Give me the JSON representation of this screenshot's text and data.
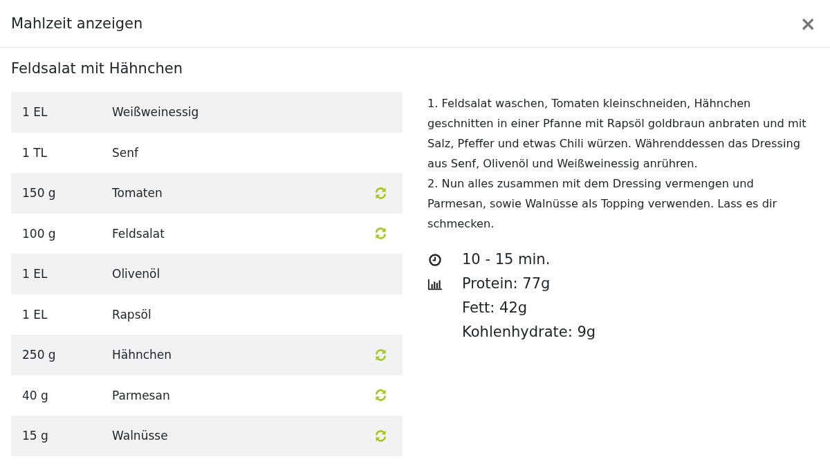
{
  "dialog": {
    "title": "Mahlzeit anzeigen",
    "close": "×"
  },
  "meal": {
    "name": "Feldsalat mit Hähnchen"
  },
  "ingredients": [
    {
      "amount": "1 EL",
      "name": "Weißweinessig",
      "replaceable": false
    },
    {
      "amount": "1 TL",
      "name": "Senf",
      "replaceable": false
    },
    {
      "amount": "150 g",
      "name": "Tomaten",
      "replaceable": true
    },
    {
      "amount": "100 g",
      "name": "Feldsalat",
      "replaceable": true
    },
    {
      "amount": "1 EL",
      "name": "Olivenöl",
      "replaceable": false
    },
    {
      "amount": "1 EL",
      "name": "Rapsöl",
      "replaceable": false
    },
    {
      "amount": "250 g",
      "name": "Hähnchen",
      "replaceable": true
    },
    {
      "amount": "40 g",
      "name": "Parmesan",
      "replaceable": true
    },
    {
      "amount": "15 g",
      "name": "Walnüsse",
      "replaceable": true
    }
  ],
  "instructions": [
    "1. Feldsalat waschen, Tomaten kleinschneiden, Hähnchen geschnitten in einer Pfanne mit Rapsöl goldbraun anbraten und mit Salz, Pfeffer und etwas Chili würzen. Währenddessen das Dressing aus Senf, Olivenöl und Weißweinessig anrühren.",
    "2. Nun alles zusammen mit dem Dressing vermengen und Parmesan, sowie Walnüsse als Topping verwenden. Lass es dir schmecken."
  ],
  "time": "10 - 15 min.",
  "nutrition": [
    "Protein: 77g",
    "Fett: 42g",
    "Kohlenhydrate: 9g"
  ]
}
